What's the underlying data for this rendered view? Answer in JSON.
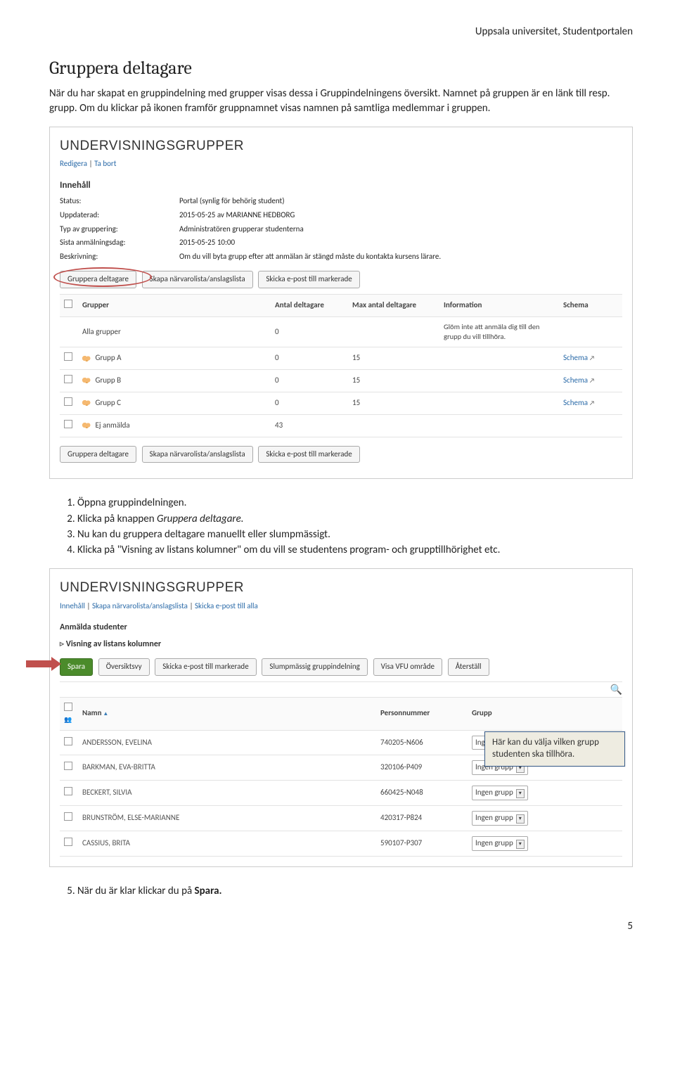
{
  "header": {
    "right": "Uppsala universitet, Studentportalen"
  },
  "title": "Gruppera deltagare",
  "para1": "När du har skapat en gruppindelning med grupper visas dessa i Gruppindelningens översikt. Namnet på gruppen är en länk till resp. grupp. Om du klickar på ikonen framför gruppnamnet visas namnen på samtliga medlemmar i gruppen.",
  "ss1": {
    "title": "UNDERVISNINGSGRUPPER",
    "links": [
      "Redigera",
      "Ta bort"
    ],
    "innerTitle": "Innehåll",
    "meta": [
      {
        "label": "Status:",
        "value": "Portal (synlig för behörig student)"
      },
      {
        "label": "Uppdaterad:",
        "value": "2015-05-25 av MARIANNE HEDBORG"
      },
      {
        "label": "Typ av gruppering:",
        "value": "Administratören grupperar studenterna"
      },
      {
        "label": "Sista anmälningsdag:",
        "value": "2015-05-25 10:00"
      },
      {
        "label": "Beskrivning:",
        "value": "Om du vill byta grupp efter att anmälan är stängd måste du kontakta kursens lärare."
      }
    ],
    "buttons_top": [
      "Gruppera deltagare",
      "Skapa närvarolista/anslagslista",
      "Skicka e-post till markerade"
    ],
    "buttons_bottom": [
      "Gruppera deltagare",
      "Skapa närvarolista/anslagslista",
      "Skicka e-post till markerade"
    ],
    "columns": [
      "",
      "Grupper",
      "Antal deltagare",
      "Max antal deltagare",
      "Information",
      "Schema"
    ],
    "rows": [
      {
        "check": false,
        "name": "Alla grupper",
        "icon": false,
        "count": "0",
        "max": "",
        "info": "Glöm inte att anmäla dig till den grupp du vill tillhöra.",
        "schema": ""
      },
      {
        "check": true,
        "name": "Grupp A",
        "icon": true,
        "count": "0",
        "max": "15",
        "info": "",
        "schema": "Schema"
      },
      {
        "check": true,
        "name": "Grupp B",
        "icon": true,
        "count": "0",
        "max": "15",
        "info": "",
        "schema": "Schema"
      },
      {
        "check": true,
        "name": "Grupp C",
        "icon": true,
        "count": "0",
        "max": "15",
        "info": "",
        "schema": "Schema"
      },
      {
        "check": true,
        "name": "Ej anmälda",
        "icon": true,
        "count": "43",
        "max": "",
        "info": "",
        "schema": ""
      }
    ]
  },
  "steps": {
    "s1": "Öppna gruppindelningen.",
    "s2a": "Klicka på knappen ",
    "s2b": "Gruppera deltagare.",
    "s3": "Nu kan du gruppera deltagare manuellt eller slumpmässigt.",
    "s4": "Klicka på \"Visning av listans kolumner\" om du vill se studentens program- och grupptillhörighet etc."
  },
  "ss2": {
    "title": "UNDERVISNINGSGRUPPER",
    "links": [
      "Innehåll",
      "Skapa närvarolista/anslagslista",
      "Skicka e-post till alla"
    ],
    "sub1": "Anmälda studenter",
    "sub2": "Visning av listans kolumner",
    "buttons": [
      "Spara",
      "Översiktsvy",
      "Skicka e-post till markerade",
      "Slumpmässig gruppindelning",
      "Visa VFU område",
      "Återställ"
    ],
    "columns": [
      "",
      "Namn",
      "Personnummer",
      "Grupp"
    ],
    "rows": [
      {
        "name": "ANDERSSON, EVELINA",
        "pnr": "740205-N606",
        "group": "Ingen grupp"
      },
      {
        "name": "BARKMAN, EVA-BRITTA",
        "pnr": "320106-P409",
        "group": "Ingen grupp"
      },
      {
        "name": "BECKERT, SILVIA",
        "pnr": "660425-N048",
        "group": "Ingen grupp"
      },
      {
        "name": "BRUNSTRÖM, ELSE-MARIANNE",
        "pnr": "420317-P824",
        "group": "Ingen grupp"
      },
      {
        "name": "CASSIUS, BRITA",
        "pnr": "590107-P307",
        "group": "Ingen grupp"
      }
    ],
    "callout": "Här kan du välja vilken grupp studenten ska tillhöra."
  },
  "step5a": "När du är klar klickar du på ",
  "step5b": "Spara.",
  "pagenum": "5"
}
